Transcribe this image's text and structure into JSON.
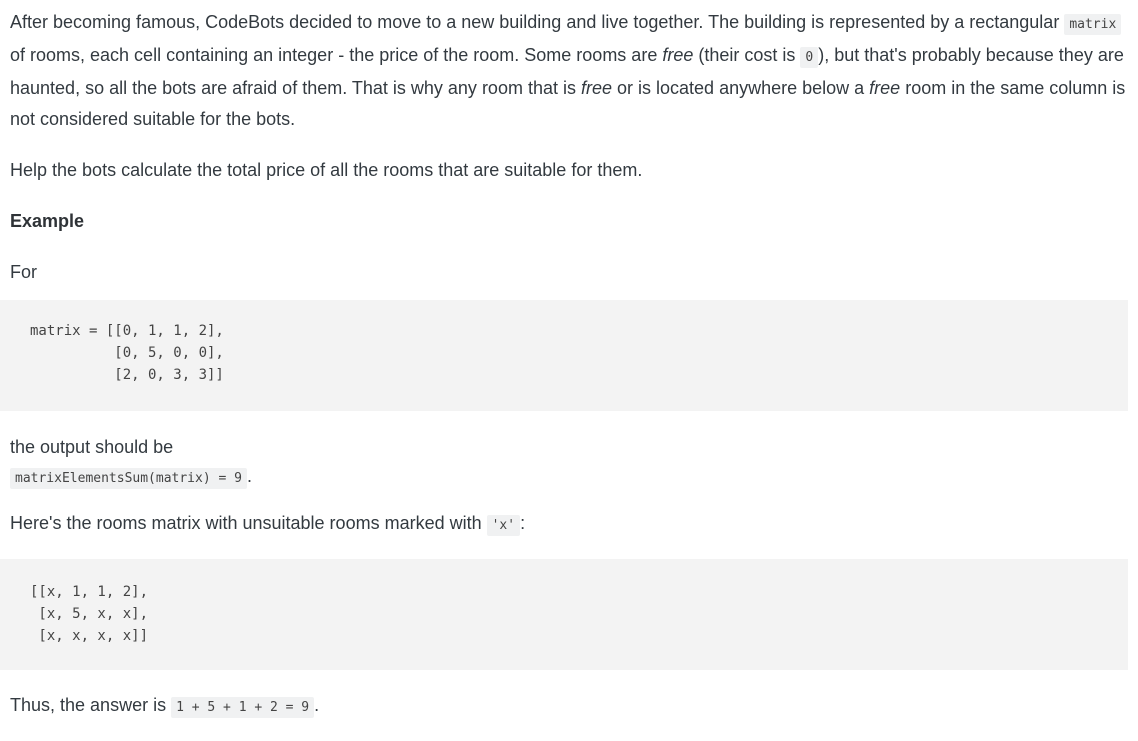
{
  "intro": {
    "s1": "After becoming famous, CodeBots decided to move to a new building and live together. The building is represented by a rectangular ",
    "code_matrix": "matrix",
    "s2": " of rooms, each cell containing an integer - the price of the room. Some rooms are ",
    "em_free1": "free",
    "s3": " (their cost is ",
    "code_zero": "0",
    "s4": "), but that's probably because they are haunted, so all the bots are afraid of them. That is why any room that is ",
    "em_free2": "free",
    "s5": " or is located anywhere below a ",
    "em_free3": "free",
    "s6": " room in the same column is not considered suitable for the bots."
  },
  "help_text": "Help the bots calculate the total price of all the rooms that are suitable for them.",
  "example_heading": "Example",
  "for_label": "For",
  "input_code": "matrix = [[0, 1, 1, 2],\n          [0, 5, 0, 0],\n          [2, 0, 3, 3]]",
  "output_label": "the output should be",
  "output_code": "matrixElementsSum(matrix) = 9",
  "output_suffix": ".",
  "marked_text": "Here's the rooms matrix with unsuitable rooms marked with ",
  "marked_code": "'x'",
  "marked_suffix": ":",
  "marked_matrix": "[[x, 1, 1, 2],\n [x, 5, x, x],\n [x, x, x, x]]",
  "answer_text": "Thus, the answer is ",
  "answer_code": "1 + 5 + 1 + 2 = 9",
  "answer_suffix": "."
}
